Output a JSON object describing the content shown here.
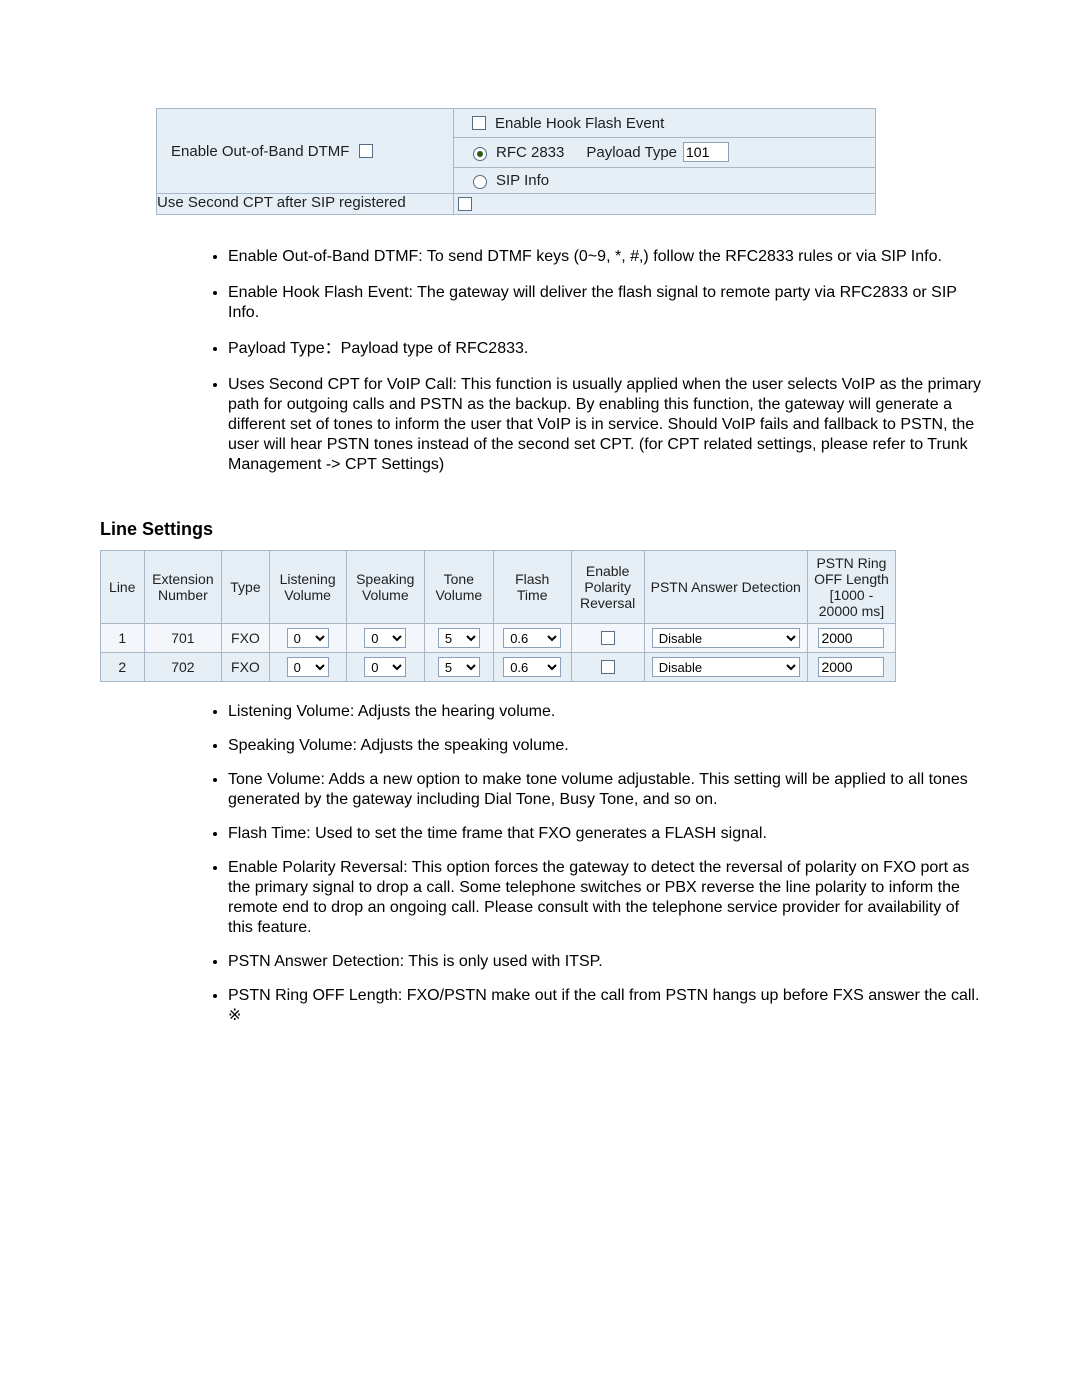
{
  "dtmf_panel": {
    "enable_oob_dtmf": {
      "label": "Enable Out-of-Band DTMF",
      "checked": false
    },
    "hook_flash": {
      "label": "Enable Hook Flash Event",
      "checked": false
    },
    "rfc2833": {
      "label": "RFC 2833",
      "selected": true,
      "payload_label": "Payload Type",
      "payload_value": "101"
    },
    "sip_info": {
      "label": "SIP Info",
      "selected": false
    },
    "second_cpt": {
      "label": "Use Second CPT after SIP registered",
      "checked": false
    }
  },
  "explain1": [
    "Enable Out-of-Band DTMF: To send DTMF keys (0~9, *, #,) follow the RFC2833 rules or via SIP Info.",
    "Enable Hook Flash Event: The gateway will deliver the flash signal to remote party via RFC2833 or SIP Info.",
    "Payload Type：Payload type of RFC2833.",
    "Uses Second CPT for VoIP Call: This function is usually applied when the user selects VoIP as the primary path for outgoing calls and PSTN as the backup. By enabling this function, the gateway will generate a different set of tones to inform the user that VoIP is in service. Should VoIP fails and fallback to PSTN, the user will hear PSTN tones instead of the second set CPT. (for CPT related settings, please refer to Trunk Management -> CPT Settings)"
  ],
  "line_section_heading": "Line Settings",
  "line_headers": {
    "line": "Line",
    "ext": "Extension Number",
    "type": "Type",
    "listen": "Listening Volume",
    "speak": "Speaking Volume",
    "tone": "Tone Volume",
    "flash": "Flash Time",
    "epr": "Enable Polarity Reversal",
    "pad": "PSTN Answer Detection",
    "rol": "PSTN Ring OFF Length [1000 - 20000 ms]"
  },
  "line_rows": [
    {
      "idx": "1",
      "ext": "701",
      "type": "FXO",
      "listen": "0",
      "speak": "0",
      "tone": "5",
      "flash": "0.6",
      "epr": false,
      "pad": "Disable",
      "rol": "2000"
    },
    {
      "idx": "2",
      "ext": "702",
      "type": "FXO",
      "listen": "0",
      "speak": "0",
      "tone": "5",
      "flash": "0.6",
      "epr": false,
      "pad": "Disable",
      "rol": "2000"
    }
  ],
  "explain2": [
    "Listening Volume: Adjusts the hearing volume.",
    "Speaking Volume: Adjusts the speaking volume.",
    "Tone Volume: Adds a new option to make tone volume adjustable. This setting will be applied to all tones generated by the gateway including Dial Tone, Busy Tone, and so on.",
    "Flash Time: Used to set the time frame that FXO generates a FLASH signal.",
    "Enable Polarity Reversal: This option forces the gateway to detect the reversal of polarity on FXO port as the primary signal to drop a call. Some telephone switches or PBX reverse the line polarity to inform the remote end to drop an ongoing call. Please consult with the telephone service provider for availability of this feature.",
    "PSTN Answer Detection: This is only used with ITSP.",
    "PSTN Ring OFF Length: FXO/PSTN make out if the call from PSTN hangs up before FXS answer the call. ※"
  ]
}
